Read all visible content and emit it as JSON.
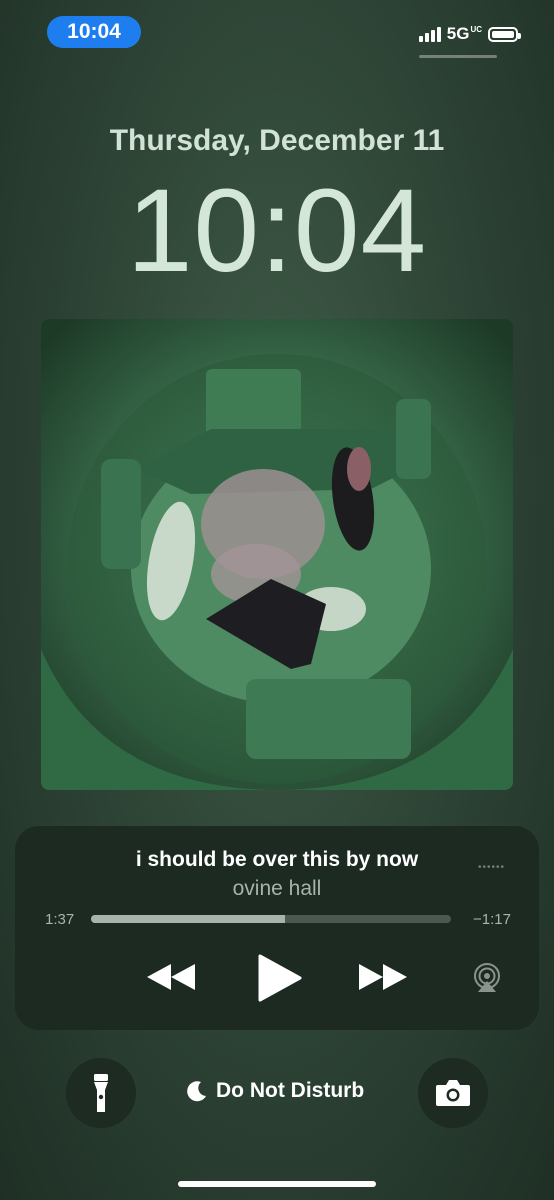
{
  "status_bar": {
    "time": "10:04",
    "network": "5G",
    "network_sup": "UC"
  },
  "lock_screen": {
    "date": "Thursday, December 11",
    "time": "10:04"
  },
  "now_playing": {
    "title": "i should be over this by now",
    "artist": "ovine hall",
    "elapsed": "1:37",
    "remaining": "−1:17",
    "progress": 0.54
  },
  "quick_actions": {
    "focus_label": "Do Not Disturb"
  },
  "icons": [
    "flashlight-icon",
    "moon-icon",
    "camera-icon",
    "rewind-icon",
    "play-icon",
    "fast-forward-icon",
    "airplay-icon",
    "more-dots-icon"
  ],
  "colors": {
    "status_pill": "#1e7ef0",
    "wallpaper": "#2c4234",
    "player_bg": "#1c2a21"
  }
}
